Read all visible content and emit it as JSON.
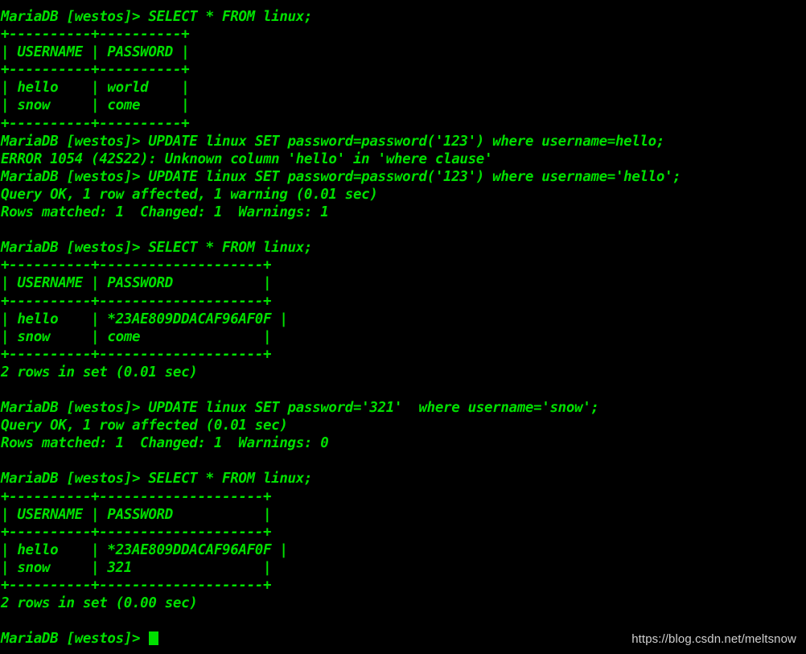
{
  "terminal": {
    "app": "MariaDB client",
    "prompt": "MariaDB [westos]> ",
    "colors": {
      "background": "#000000",
      "foreground": "#00e000",
      "watermark": "#cfcfcf"
    },
    "cursor": {
      "shape": "block",
      "visible": true,
      "color": "#00e000"
    },
    "lines": [
      "MariaDB [westos]> SELECT * FROM linux;",
      "+----------+----------+",
      "| USERNAME | PASSWORD |",
      "+----------+----------+",
      "| hello    | world    |",
      "| snow     | come     |",
      "+----------+----------+",
      "MariaDB [westos]> UPDATE linux SET password=password('123') where username=hello;",
      "ERROR 1054 (42S22): Unknown column 'hello' in 'where clause'",
      "MariaDB [westos]> UPDATE linux SET password=password('123') where username='hello';",
      "Query OK, 1 row affected, 1 warning (0.01 sec)",
      "Rows matched: 1  Changed: 1  Warnings: 1",
      "",
      "MariaDB [westos]> SELECT * FROM linux;",
      "+----------+--------------------+",
      "| USERNAME | PASSWORD           |",
      "+----------+--------------------+",
      "| hello    | *23AE809DDACAF96AF0F |",
      "| snow     | come               |",
      "+----------+--------------------+",
      "2 rows in set (0.01 sec)",
      "",
      "MariaDB [westos]> UPDATE linux SET password='321'  where username='snow';",
      "Query OK, 1 row affected (0.01 sec)",
      "Rows matched: 1  Changed: 1  Warnings: 0",
      "",
      "MariaDB [westos]> SELECT * FROM linux;",
      "+----------+--------------------+",
      "| USERNAME | PASSWORD           |",
      "+----------+--------------------+",
      "| hello    | *23AE809DDACAF96AF0F |",
      "| snow     | 321                |",
      "+----------+--------------------+",
      "2 rows in set (0.00 sec)",
      ""
    ],
    "final_prompt": "MariaDB [westos]> "
  },
  "watermark": {
    "text": "https://blog.csdn.net/meltsnow"
  }
}
